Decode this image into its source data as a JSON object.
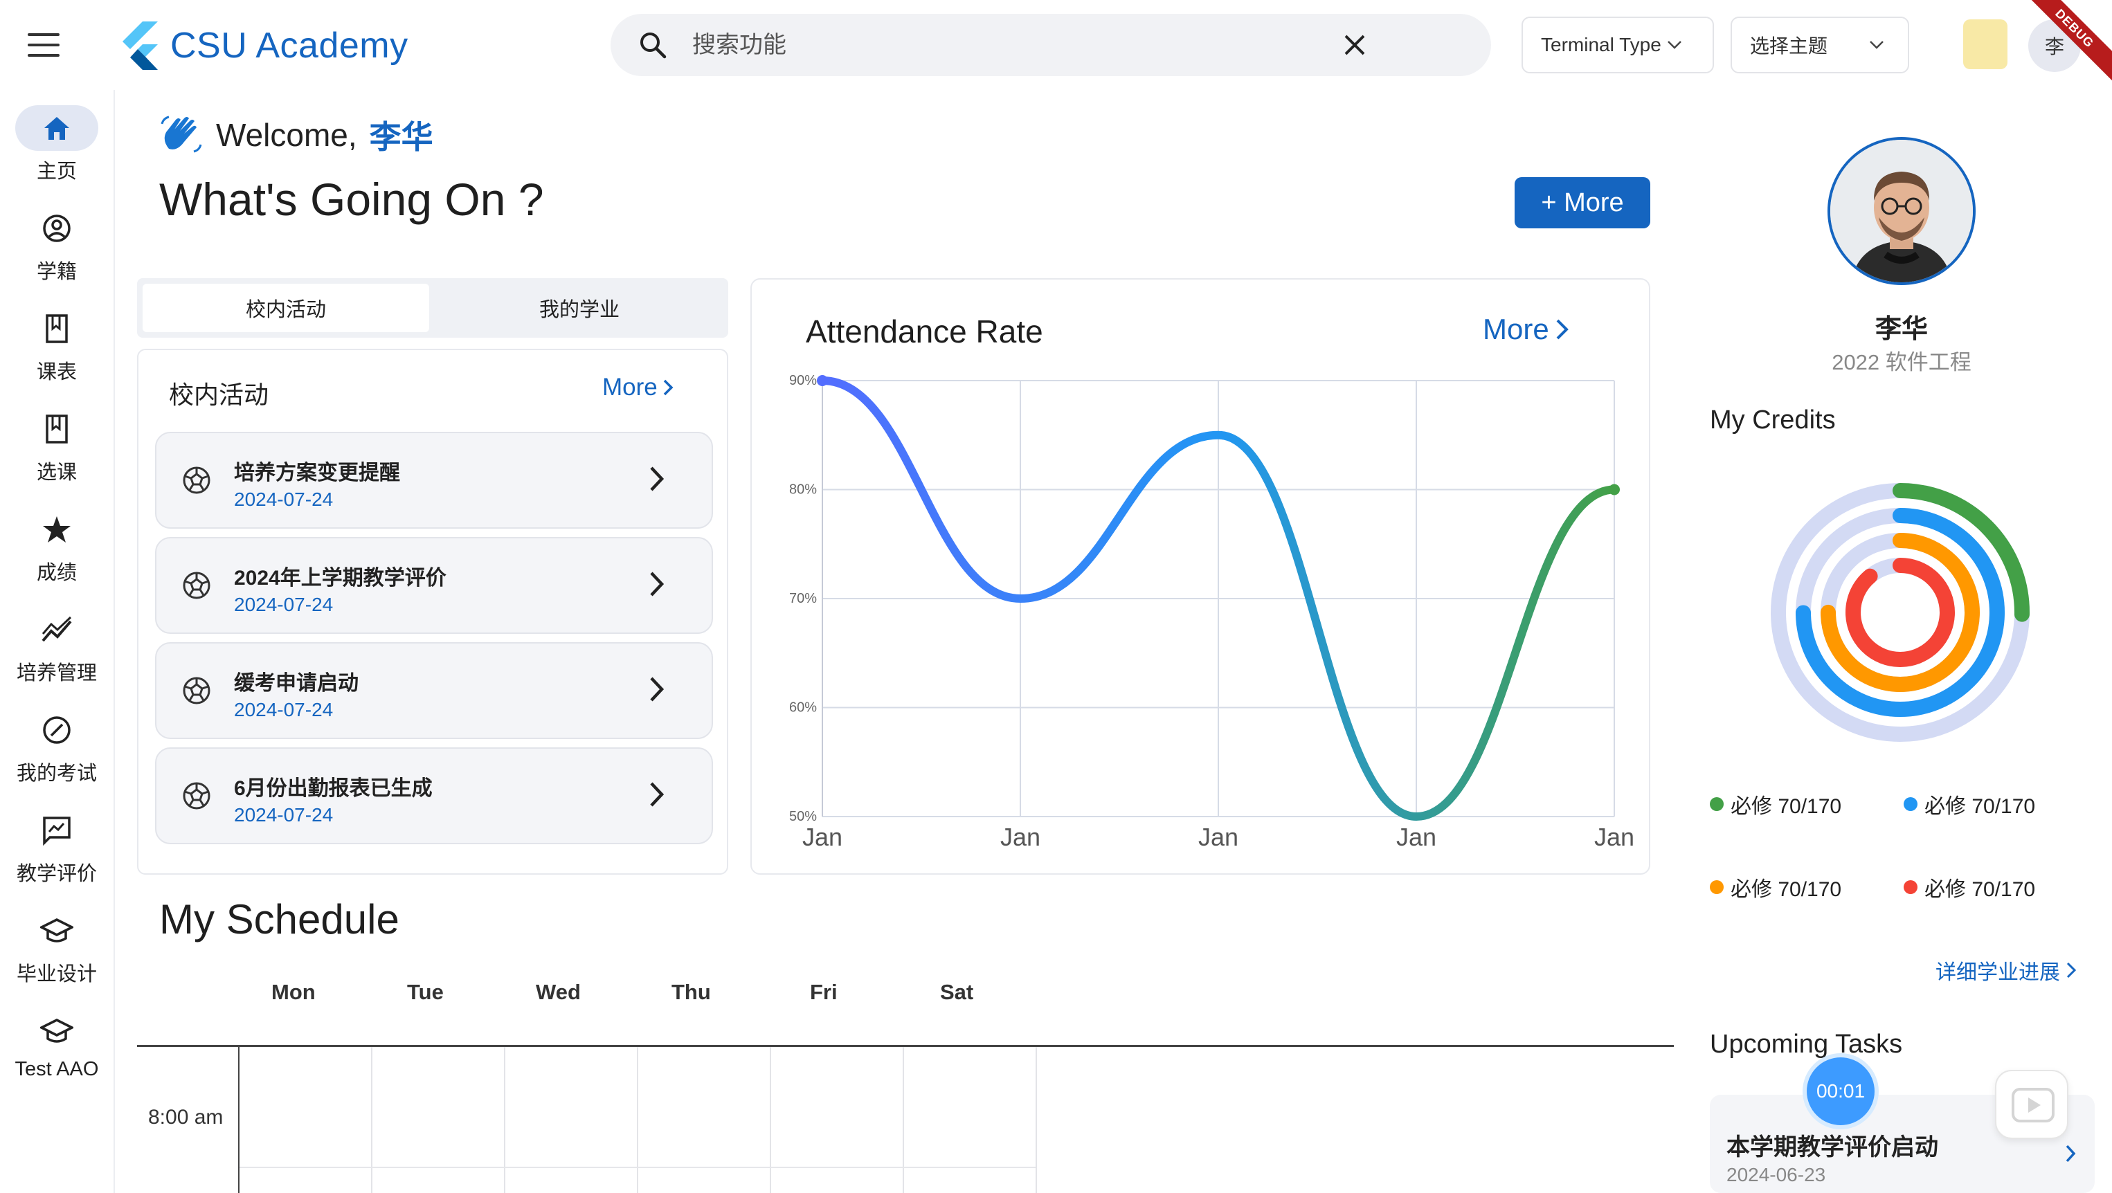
{
  "app": {
    "title": "CSU Academy",
    "search_placeholder": "搜索功能",
    "terminal_dropdown": "Terminal Type",
    "theme_dropdown": "选择主题",
    "avatar_initial": "李",
    "debug_label": "DEBUG"
  },
  "nav": [
    {
      "label": "主页",
      "icon": "home-icon",
      "active": true
    },
    {
      "label": "学籍",
      "icon": "account-circle-icon"
    },
    {
      "label": "课表",
      "icon": "bookmark-icon"
    },
    {
      "label": "选课",
      "icon": "bookmark-icon"
    },
    {
      "label": "成绩",
      "icon": "star-icon"
    },
    {
      "label": "培养管理",
      "icon": "trend-icon"
    },
    {
      "label": "我的考试",
      "icon": "compass-icon"
    },
    {
      "label": "教学评价",
      "icon": "feedback-icon"
    },
    {
      "label": "毕业设计",
      "icon": "graduation-cap-icon"
    },
    {
      "label": "Test AAO",
      "icon": "graduation-cap-icon"
    }
  ],
  "welcome": {
    "greeting": "Welcome,",
    "name": "李华",
    "headline": "What's Going On ?",
    "more_button": "+ More"
  },
  "tabs": [
    "校内活动",
    "我的学业"
  ],
  "activities": {
    "title": "校内活动",
    "more": "More",
    "items": [
      {
        "title": "培养方案变更提醒",
        "date": "2024-07-24"
      },
      {
        "title": "2024年上学期教学评价",
        "date": "2024-07-24"
      },
      {
        "title": "缓考申请启动",
        "date": "2024-07-24"
      },
      {
        "title": "6月份出勤报表已生成",
        "date": "2024-07-24"
      }
    ]
  },
  "attendance": {
    "title": "Attendance Rate",
    "more": "More"
  },
  "chart_data": {
    "type": "line",
    "title": "Attendance Rate",
    "categories": [
      "Jan",
      "Jan",
      "Jan",
      "Jan",
      "Jan"
    ],
    "series": [
      {
        "values": [
          90,
          70,
          85,
          50,
          80
        ]
      }
    ],
    "y_ticks": [
      "90%",
      "80%",
      "70%",
      "60%",
      "50%"
    ],
    "ylim": [
      50,
      90
    ],
    "grid": true,
    "line_gradient": [
      "#536dfe",
      "#2196f3",
      "#43a047"
    ]
  },
  "schedule": {
    "title": "My Schedule",
    "days": [
      "Mon",
      "Tue",
      "Wed",
      "Thu",
      "Fri",
      "Sat"
    ],
    "times": [
      "8:00 am"
    ]
  },
  "profile": {
    "name": "李华",
    "subtitle": "2022 软件工程"
  },
  "credits": {
    "title": "My Credits",
    "legend": [
      {
        "label": "必修 70/170",
        "color": "#43a047"
      },
      {
        "label": "必修 70/170",
        "color": "#2196f3"
      },
      {
        "label": "必修 70/170",
        "color": "#ff9800"
      },
      {
        "label": "必修 70/170",
        "color": "#f44336"
      }
    ],
    "detail_link": "详细学业进展"
  },
  "tasks": {
    "title": "Upcoming Tasks",
    "timer": "00:01",
    "items": [
      {
        "title": "本学期教学评价启动",
        "date": "2024-06-23"
      }
    ]
  }
}
